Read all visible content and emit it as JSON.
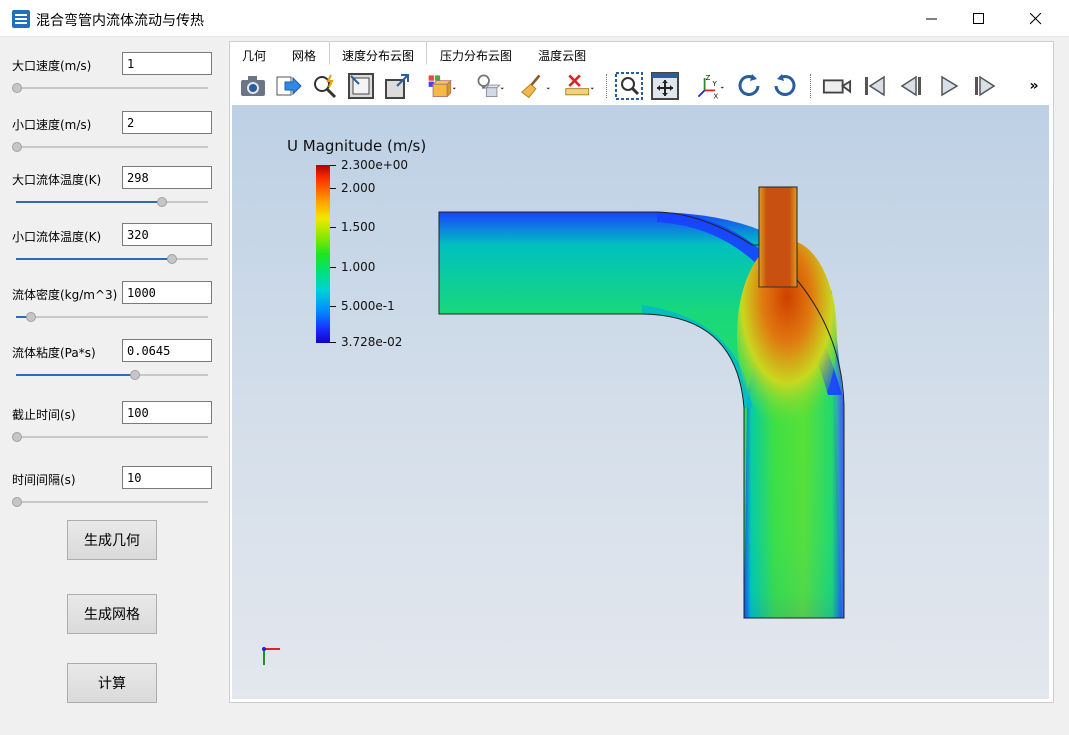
{
  "window": {
    "title": "混合弯管内流体流动与传热"
  },
  "params": [
    {
      "label": "大口速度(m/s)",
      "value": "1",
      "slider_fraction": 0.0
    },
    {
      "label": "小口速度(m/s)",
      "value": "2",
      "slider_fraction": 0.0
    },
    {
      "label": "大口流体温度(K)",
      "value": "298",
      "slider_fraction": 0.76
    },
    {
      "label": "小口流体温度(K)",
      "value": "320",
      "slider_fraction": 0.81
    },
    {
      "label": "流体密度(kg/m^3)",
      "value": "1000",
      "slider_fraction": 0.08
    },
    {
      "label": "流体粘度(Pa*s)",
      "value": "0.0645",
      "slider_fraction": 0.62
    },
    {
      "label": "截止时间(s)",
      "value": "100",
      "slider_fraction": 0.0
    },
    {
      "label": "时间间隔(s)",
      "value": "10",
      "slider_fraction": 0.0
    }
  ],
  "buttons": {
    "geometry": "生成几何",
    "mesh": "生成网格",
    "compute": "计算"
  },
  "tabs": [
    "几何",
    "网格",
    "速度分布云图",
    "压力分布云图",
    "温度云图"
  ],
  "active_tab": 2,
  "toolbar_icons": [
    "camera-icon",
    "export-icon",
    "pick-icon",
    "reset-view-icon",
    "fullscreen-icon",
    "box-icon",
    "light-icon",
    "brush-icon",
    "ruler-delete-icon",
    "zoom-box-icon",
    "fit-view-icon",
    "axes-icon",
    "rotate-cw-icon",
    "rotate-ccw-icon",
    "video-icon",
    "first-frame-icon",
    "prev-frame-icon",
    "play-icon",
    "last-frame-icon",
    "more-icon"
  ],
  "toolbar_more": "»",
  "legend": {
    "title": "U Magnitude (m/s)",
    "labels": [
      "2.300e+00",
      "2.000",
      "1.500",
      "1.000",
      "5.000e-1",
      "3.728e-02"
    ],
    "min": 0.03728,
    "max": 2.3,
    "values": [
      2.3,
      2.0,
      1.5,
      1.0,
      0.5,
      0.03728
    ]
  },
  "colors": {
    "accent": "#2d6bb4",
    "viewport_top": "#bdd0e5",
    "viewport_bottom": "#e3e7ee"
  }
}
